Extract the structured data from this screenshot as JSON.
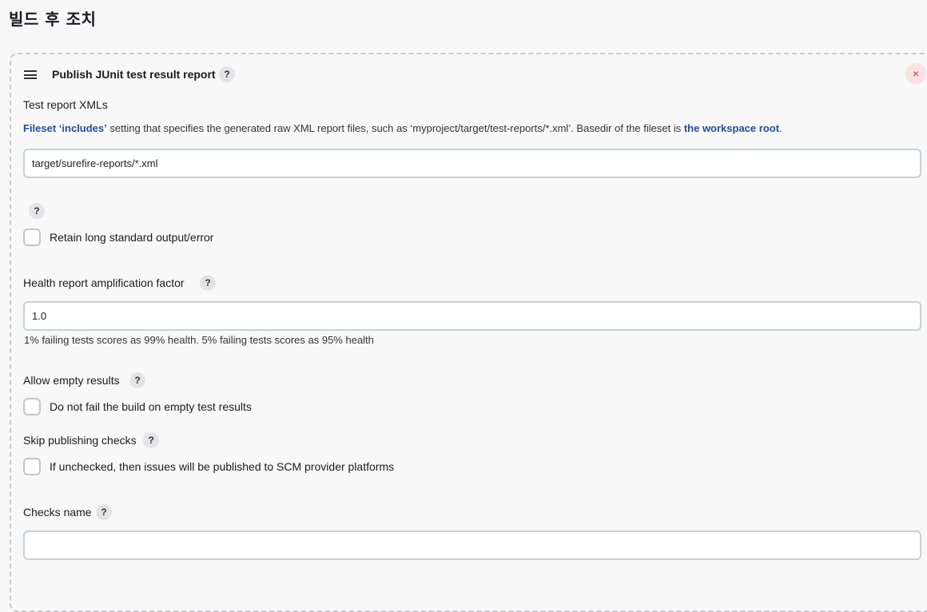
{
  "section": {
    "title": "빌드 후 조치"
  },
  "step": {
    "title": "Publish JUnit test result report",
    "help": "?",
    "close": "×"
  },
  "test_report": {
    "label": "Test report XMLs",
    "desc_link1": "Fileset ‘includes’",
    "desc_mid": " setting that specifies the generated raw XML report files, such as ‘myproject/target/test-reports/*.xml’. Basedir of the fileset is ",
    "desc_link2": "the workspace root",
    "desc_end": ".",
    "value": "target/surefire-reports/*.xml"
  },
  "retain": {
    "help": "?",
    "label": "Retain long standard output/error"
  },
  "health": {
    "label": "Health report amplification factor",
    "help": "?",
    "value": "1.0",
    "desc": "1% failing tests scores as 99% health. 5% failing tests scores as 95% health"
  },
  "allow_empty": {
    "label": "Allow empty results",
    "help": "?",
    "checkbox_label": "Do not fail the build on empty test results"
  },
  "skip_checks": {
    "label": "Skip publishing checks",
    "help": "?",
    "checkbox_label": "If unchecked, then issues will be published to SCM provider platforms"
  },
  "checks_name": {
    "label": "Checks name",
    "help": "?",
    "value": ""
  }
}
